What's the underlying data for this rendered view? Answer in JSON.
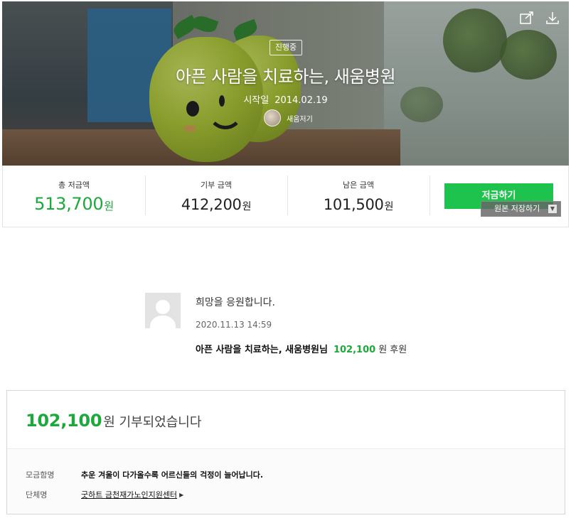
{
  "hero": {
    "status": "진행중",
    "title": "아픈 사람을 치료하는, 새움병원",
    "start_label": "시작일",
    "start_date": "2014.02.19",
    "org_name": "새움저기",
    "icons": [
      "share-icon",
      "download-icon"
    ]
  },
  "stats": {
    "total_label": "총 저금액",
    "total_value": "513,700",
    "donated_label": "기부 금액",
    "donated_value": "412,200",
    "remaining_label": "남은 금액",
    "remaining_value": "101,500",
    "unit": "원",
    "donate_button": "저금하기",
    "save_original": "원본 저장하기"
  },
  "comment": {
    "text": "희망을 응원합니다.",
    "datetime": "2020.11.13 14:59",
    "org": "아픈 사람을 치료하는, 새움병원님",
    "amount": "102,100",
    "suffix": "원 후원"
  },
  "donation_card": {
    "amount": "102,100",
    "message": "원 기부되었습니다",
    "campaign_label": "모금함명",
    "campaign_value": "추운 겨울이 다가올수록 어르신들의 걱정이 늘어납니다.",
    "org_label": "단체명",
    "org_value": "굿하트 금천재가노인지원센터"
  },
  "colors": {
    "accent_green": "#1ca83b",
    "button_green": "#1ec34d"
  }
}
